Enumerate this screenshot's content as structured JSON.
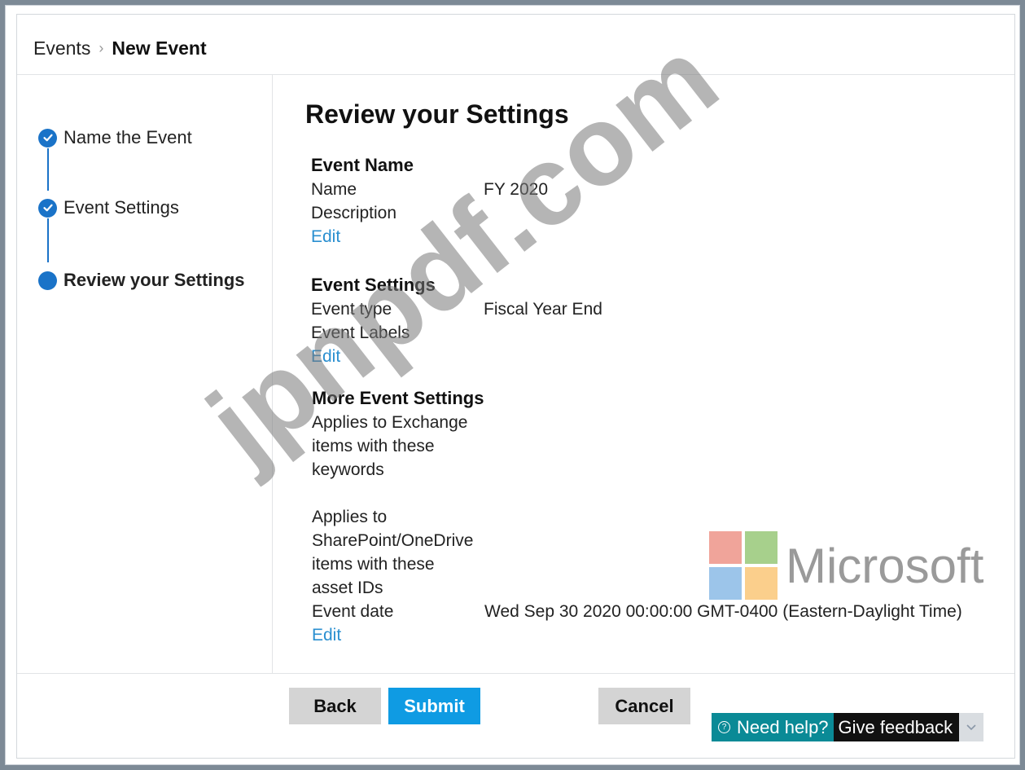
{
  "breadcrumb": {
    "root": "Events",
    "current": "New Event"
  },
  "steps": [
    {
      "label": "Name the Event",
      "state": "done"
    },
    {
      "label": "Event Settings",
      "state": "done"
    },
    {
      "label": "Review your Settings",
      "state": "current"
    }
  ],
  "review": {
    "title": "Review your Settings",
    "event_name": {
      "title": "Event Name",
      "name_key": "Name",
      "name_value": "FY 2020",
      "description_key": "Description",
      "edit": "Edit"
    },
    "event_settings": {
      "title": "Event Settings",
      "type_key": "Event type",
      "type_value": "Fiscal Year End",
      "labels_key": "Event Labels",
      "edit": "Edit"
    },
    "more_settings": {
      "title": "More Event Settings",
      "exchange_line1": "Applies to Exchange",
      "exchange_line2": "items with these",
      "exchange_line3": "keywords",
      "sp_line1": "Applies to",
      "sp_line2": "SharePoint/OneDrive",
      "sp_line3": "items with these",
      "sp_line4": "asset IDs",
      "date_key": "Event date",
      "date_value": "Wed Sep 30 2020 00:00:00 GMT-0400 (Eastern-Daylight Time)",
      "edit": "Edit"
    }
  },
  "buttons": {
    "back": "Back",
    "submit": "Submit",
    "cancel": "Cancel"
  },
  "help": {
    "need_help": "Need help?",
    "give_feedback": "Give feedback"
  },
  "logo": {
    "text": "Microsoft",
    "colors": [
      "#f0a49a",
      "#a7d08c",
      "#9cc5ea",
      "#fbcf8c"
    ]
  },
  "watermark": {
    "text": "jpnpdf.com"
  },
  "colors": {
    "accent": "#1a73c8",
    "submit": "#0f9be3",
    "link": "#2a8fd0",
    "help": "#0a8a96"
  }
}
